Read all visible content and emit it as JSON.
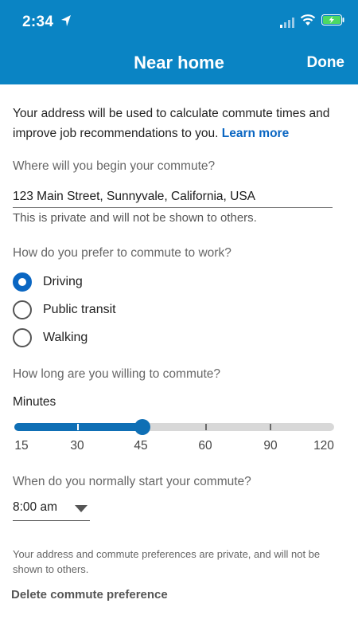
{
  "status_bar": {
    "time": "2:34"
  },
  "nav": {
    "title": "Near home",
    "done": "Done"
  },
  "intro": {
    "text": "Your address will be used to calculate commute times and improve job recommendations to you. ",
    "link": "Learn more"
  },
  "address": {
    "label": "Where will you begin your commute?",
    "value": "123 Main Street, Sunnyvale, California, USA",
    "note": "This is private and will not be shown to others."
  },
  "mode": {
    "label": "How do you prefer to commute to work?",
    "options": [
      {
        "label": "Driving",
        "selected": true
      },
      {
        "label": "Public transit",
        "selected": false
      },
      {
        "label": "Walking",
        "selected": false
      }
    ]
  },
  "duration": {
    "label": "How long are you willing to commute?",
    "unit": "Minutes",
    "ticks": [
      "15",
      "30",
      "45",
      "60",
      "90",
      "120"
    ],
    "selected": "45"
  },
  "start_time": {
    "label": "When do you normally start your commute?",
    "value": "8:00 am"
  },
  "footer": {
    "note": "Your address and commute preferences are private, and will not be shown to others.",
    "delete": "Delete commute preference"
  },
  "colors": {
    "header": "#0a84c4",
    "accent": "#0a66c2",
    "slider": "#0f6fb5"
  }
}
